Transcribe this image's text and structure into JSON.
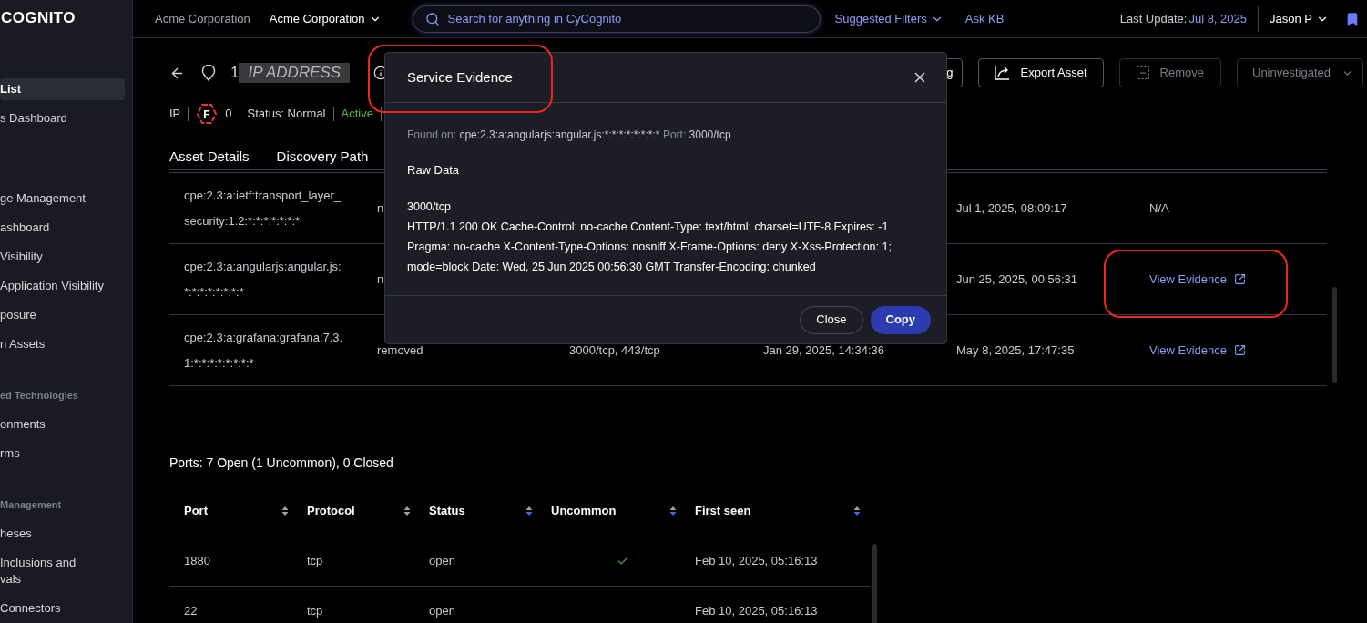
{
  "sidebar": {
    "logo": "COGNITO",
    "groups": [
      {
        "items": [
          {
            "label": "List",
            "selected": true
          },
          {
            "label": "s Dashboard",
            "selected": false
          }
        ]
      },
      {
        "items": [
          {
            "label": "ge Management",
            "selected": false
          },
          {
            "label": "ashboard",
            "selected": false
          },
          {
            "label": " Visibility",
            "selected": false
          },
          {
            "label": "Application Visibility",
            "selected": false
          },
          {
            "label": "posure",
            "selected": false
          },
          {
            "label": "n Assets",
            "selected": false
          }
        ]
      },
      {
        "heading": "ed Technologies",
        "items": [
          {
            "label": "onments",
            "selected": false
          },
          {
            "label": "rms",
            "selected": false
          }
        ]
      },
      {
        "heading": "Management",
        "items": [
          {
            "label": "heses",
            "selected": false
          },
          {
            "label": " Inclusions and\nvals",
            "selected": false
          },
          {
            "label": " Connectors",
            "selected": false
          }
        ]
      }
    ]
  },
  "topbar": {
    "organization": "Acme Corporation",
    "org_selector": "Acme Corporation",
    "search": {
      "placeholder": "Search for anything in CyCognito"
    },
    "links": [
      {
        "label": "Suggested Filters",
        "dropdown": true
      },
      {
        "label": "Ask KB",
        "dropdown": false
      }
    ],
    "last_update_label": "Last Update:",
    "last_update_value": "Jul 8, 2025",
    "user": "Jason P"
  },
  "asset": {
    "id_prefix": "1",
    "id_redacted": "IP ADDRESS",
    "actions": [
      {
        "kind": "plain",
        "label": "g",
        "disabled": false
      },
      {
        "kind": "export",
        "label": "Export Asset",
        "disabled": false
      },
      {
        "kind": "remove",
        "label": "Remove",
        "disabled": true
      },
      {
        "kind": "dropdown",
        "label": "Uninvestigated",
        "disabled": true
      }
    ],
    "meta": {
      "type": "IP",
      "grade": "F",
      "grade_count": "0",
      "status": "Status: Normal",
      "activity": "Active"
    }
  },
  "tabs": [
    {
      "label": "Asset Details"
    },
    {
      "label": "Discovery Path"
    }
  ],
  "tech_table": {
    "rows": [
      {
        "cells": [
          "cpe:2.3:a:ietf:transport_layer_security:1.2:*:*:*:*:*:*:*",
          "n",
          "",
          "",
          "Jul 1, 2025, 08:09:17"
        ],
        "evidence": {
          "kind": "text",
          "label": "N/A"
        }
      },
      {
        "cells": [
          "cpe:2.3:a:angularjs:angular.js:*:*:*:*:*:*:*:*",
          "n",
          "",
          "",
          "Jun 25, 2025, 00:56:31"
        ],
        "evidence": {
          "kind": "link",
          "label": "View Evidence"
        }
      },
      {
        "cells": [
          "cpe:2.3:a:grafana:grafana:7.3.1:*:*:*:*:*:*:*:*",
          "removed",
          "3000/tcp, 443/tcp",
          "Jan 29, 2025, 14:34:36",
          "May 8, 2025, 17:47:35"
        ],
        "evidence": {
          "kind": "link",
          "label": "View Evidence"
        }
      }
    ]
  },
  "ports": {
    "title": "Ports: 7 Open (1 Uncommon), 0 Closed",
    "columns": [
      {
        "label": "Port",
        "sorted": false
      },
      {
        "label": "Protocol",
        "sorted": false
      },
      {
        "label": "Status",
        "sorted": true
      },
      {
        "label": "Uncommon",
        "sorted": true
      },
      {
        "label": "First seen",
        "sorted": true
      }
    ],
    "rows": [
      {
        "port": "1880",
        "protocol": "tcp",
        "status": "open",
        "uncommon": true,
        "first_seen": "Feb 10, 2025, 05:16:13"
      },
      {
        "port": "22",
        "protocol": "tcp",
        "status": "open",
        "uncommon": false,
        "first_seen": "Feb 10, 2025, 05:16:13"
      }
    ]
  },
  "modal": {
    "title": "Service Evidence",
    "found_on_label": "Found on:",
    "found_on_value": "cpe:2.3:a:angularjs:angular.js:*:*:*:*:*:*:*:*",
    "port_label": "Port:",
    "port_value": "3000/tcp",
    "section": "Raw Data",
    "raw_port": "3000/tcp",
    "raw_data": "HTTP/1.1 200 OK Cache-Control: no-cache Content-Type: text/html; charset=UTF-8 Expires: -1 Pragma: no-cache X-Content-Type-Options: nosniff X-Frame-Options: deny X-Xss-Protection: 1; mode=block Date: Wed, 25 Jun 2025 00:56:30 GMT Transfer-Encoding: chunked",
    "buttons": [
      {
        "kind": "secondary",
        "label": "Close"
      },
      {
        "kind": "primary",
        "label": "Copy"
      }
    ]
  },
  "annotations": [
    {
      "kind": "outline"
    },
    {
      "kind": "outline"
    }
  ]
}
